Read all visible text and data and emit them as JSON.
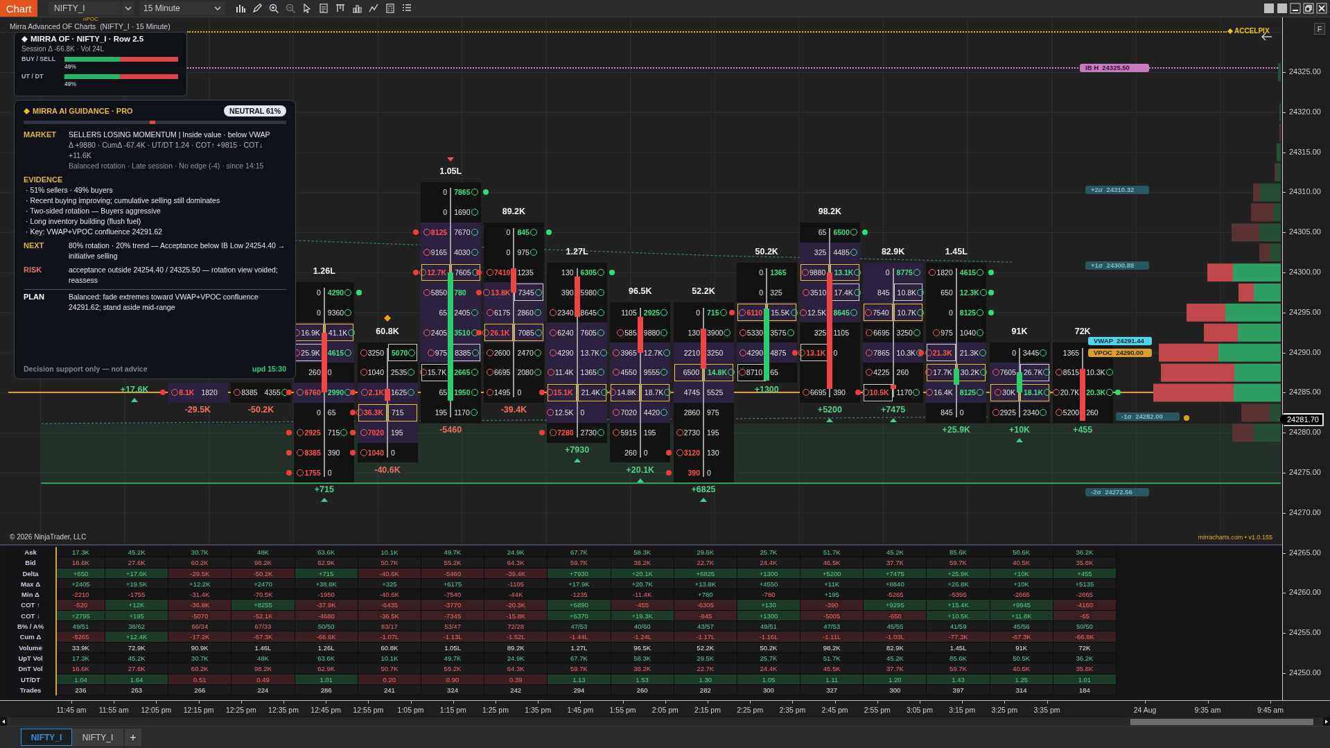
{
  "toolbar": {
    "menu_button": "Chart",
    "instrument": "NIFTY_I",
    "interval": "15 Minute"
  },
  "chart": {
    "title": "Mirra Advanced OF Charts  (NIFTY_I · 15 Minute)",
    "npoc_label": "nPOC",
    "accel_label": "ACCELPIX",
    "credit": "mirracharts.com • v1.0.155",
    "copyright": "© 2026 NinjaTrader, LLC",
    "levels": [
      {
        "kind": "ib_high",
        "name": "IB H",
        "value": "24325.50"
      },
      {
        "kind": "sigma",
        "name": "+2σ",
        "value": "24310.32"
      },
      {
        "kind": "sigma",
        "name": "+1σ",
        "value": "24300.88"
      },
      {
        "kind": "vwap",
        "name": "VWAP",
        "value": "24291.44"
      },
      {
        "kind": "vpoc",
        "name": "VPOC",
        "value": "24290.00"
      },
      {
        "kind": "sigma",
        "name": "-1σ",
        "value": "24282.00"
      },
      {
        "kind": "sigma",
        "name": "-2σ",
        "value": "24272.56"
      }
    ],
    "footprint": {
      "bars": [
        {
          "delta": "+17.6K",
          "delta_positive": true,
          "marker": {
            "kind": "up"
          }
        },
        {
          "delta": "-29.5K",
          "delta_positive": false,
          "rows": [
            {
              "bid": "8.1K",
              "bid_ring": true,
              "bid_strong": true,
              "ask": "1820",
              "shaded": true,
              "dot_left": true
            }
          ]
        },
        {
          "delta": "-50.2K",
          "delta_positive": false,
          "rows": [
            {
              "bid": "8385",
              "bid_ring": true,
              "ask": "4355",
              "ask_ring": true
            }
          ]
        },
        {
          "volume": "1.26L",
          "delta": "+715",
          "delta_positive": true,
          "marker": {
            "kind": "up"
          },
          "candle_rising": false,
          "rows": [
            {
              "bid": "0",
              "ask": "4290",
              "ask_strong": true,
              "ask_ring": true,
              "dot_right": true
            },
            {
              "bid": "0",
              "ask": "9360",
              "ask_ring": true
            },
            {
              "bid": "16.9K",
              "bid_ring": true,
              "bid_highlight": true,
              "ask": "41.1K",
              "ask_ring": true,
              "ask_highlight": true,
              "shaded": true
            },
            {
              "bid": "25.9K",
              "bid_ring": true,
              "bid_outline": true,
              "ask": "4615",
              "ask_strong": true,
              "ask_ring": true,
              "shaded": true
            },
            {
              "bid": "260",
              "ask": "0"
            },
            {
              "bid": "6760",
              "bid_ring": true,
              "bid_strong": true,
              "ask": "2990",
              "ask_strong": true,
              "ask_ring": true,
              "shaded": true,
              "dot_left": true
            },
            {
              "bid": "0",
              "ask": "65"
            },
            {
              "bid": "2925",
              "bid_ring": true,
              "bid_strong": true,
              "ask": "715",
              "ask_ring": true,
              "dot_left": true
            },
            {
              "bid": "8385",
              "bid_ring": true,
              "bid_strong": true,
              "ask": "390",
              "dot_left": true
            },
            {
              "bid": "1755",
              "bid_ring": true,
              "bid_strong": true,
              "ask": "0",
              "dot_left": true
            }
          ]
        },
        {
          "volume": "60.8K",
          "delta": "-40.6K",
          "delta_positive": false,
          "marker": {
            "kind": "diamond"
          },
          "candle_rising": false,
          "rows": [
            {
              "bid": "3250",
              "bid_ring": true,
              "ask": "5070",
              "ask_strong": true,
              "ask_ring": true,
              "ask_outline": true
            },
            {
              "bid": "1040",
              "bid_ring": true,
              "ask": "2535",
              "ask_ring": true
            },
            {
              "bid": "2.1K",
              "bid_ring": true,
              "bid_strong": true,
              "ask": "1625",
              "ask_ring": true,
              "shaded": true,
              "dot_left": true
            },
            {
              "bid": "36.3K",
              "bid_ring": true,
              "bid_strong": true,
              "bid_highlight": true,
              "ask": "715",
              "ask_highlight": true,
              "shaded": true,
              "dot_left": true
            },
            {
              "bid": "7020",
              "bid_ring": true,
              "bid_strong": true,
              "ask": "195",
              "shaded": true,
              "dot_left": true
            },
            {
              "bid": "1040",
              "bid_ring": true,
              "bid_strong": true,
              "ask": "0",
              "dot_left": true
            }
          ]
        },
        {
          "volume": "1.05L",
          "delta": "-5460",
          "delta_positive": false,
          "marker": {
            "kind": "down"
          },
          "candle_rising": true,
          "rows": [
            {
              "bid": "0",
              "ask": "7865",
              "ask_strong": true,
              "ask_ring": true,
              "dot_right": true
            },
            {
              "bid": "0",
              "ask": "1690",
              "ask_ring": true
            },
            {
              "bid": "8125",
              "bid_ring": true,
              "bid_strong": true,
              "ask": "7670",
              "ask_ring": true,
              "shaded": true,
              "dot_left": true
            },
            {
              "bid": "9165",
              "bid_ring": true,
              "ask": "4030",
              "ask_ring": true,
              "shaded": true
            },
            {
              "bid": "12.7K",
              "bid_ring": true,
              "bid_strong": true,
              "bid_highlight": true,
              "ask": "7605",
              "ask_ring": true,
              "ask_highlight": true,
              "shaded": true,
              "dot_left": true
            },
            {
              "bid": "5850",
              "bid_ring": true,
              "ask": "780",
              "ask_strong": true,
              "shaded": true
            },
            {
              "bid": "65",
              "ask": "2405",
              "ask_ring": true,
              "shaded": true
            },
            {
              "bid": "2405",
              "bid_ring": true,
              "ask": "3510",
              "ask_strong": true,
              "ask_ring": true,
              "shaded": true
            },
            {
              "bid": "975",
              "bid_ring": true,
              "ask": "8385",
              "ask_ring": true,
              "ask_outline": true,
              "shaded": true
            },
            {
              "bid": "15.7K",
              "bid_ring": true,
              "bid_outline": true,
              "ask": "2665",
              "ask_strong": true,
              "ask_ring": true
            },
            {
              "bid": "65",
              "ask": "1950",
              "ask_strong": true,
              "ask_ring": true
            },
            {
              "bid": "195",
              "ask": "1170",
              "ask_ring": true
            }
          ]
        },
        {
          "volume": "89.2K",
          "delta": "-39.4K",
          "delta_positive": false,
          "candle_rising": false,
          "rows": [
            {
              "bid": "0",
              "ask": "845",
              "ask_strong": true,
              "ask_ring": true,
              "dot_right": true
            },
            {
              "bid": "0",
              "ask": "975",
              "ask_ring": true
            },
            {
              "bid": "7410",
              "bid_ring": true,
              "bid_strong": true,
              "ask": "1235",
              "dot_left": true
            },
            {
              "bid": "13.8K",
              "bid_ring": true,
              "bid_strong": true,
              "ask": "7345",
              "ask_ring": true,
              "ask_outline": true,
              "shaded": true,
              "dot_left": true
            },
            {
              "bid": "6175",
              "bid_ring": true,
              "ask": "2860",
              "ask_ring": true,
              "shaded": true
            },
            {
              "bid": "26.1K",
              "bid_ring": true,
              "bid_strong": true,
              "bid_highlight": true,
              "ask": "7085",
              "ask_ring": true,
              "ask_highlight": true,
              "shaded": true,
              "dot_left": true
            },
            {
              "bid": "2600",
              "bid_ring": true,
              "ask": "2470",
              "ask_ring": true
            },
            {
              "bid": "6695",
              "bid_ring": true,
              "ask": "2080",
              "ask_ring": true
            },
            {
              "bid": "1495",
              "bid_ring": true,
              "ask": "0"
            }
          ]
        },
        {
          "volume": "1.27L",
          "delta": "+7930",
          "delta_positive": true,
          "marker": {
            "kind": "up"
          },
          "candle_rising": false,
          "rows": [
            {
              "bid": "130",
              "ask": "6305",
              "ask_strong": true,
              "ask_ring": true,
              "dot_right": true
            },
            {
              "bid": "390",
              "ask": "5980",
              "ask_ring": true
            },
            {
              "bid": "2340",
              "bid_ring": true,
              "ask": "8645",
              "ask_ring": true
            },
            {
              "bid": "6240",
              "bid_ring": true,
              "ask": "7605",
              "ask_ring": true,
              "shaded": true
            },
            {
              "bid": "4290",
              "bid_ring": true,
              "ask": "13.7K",
              "ask_ring": true,
              "shaded": true
            },
            {
              "bid": "11.4K",
              "bid_ring": true,
              "ask": "1365",
              "ask_ring": true,
              "shaded": true
            },
            {
              "bid": "15.1K",
              "bid_ring": true,
              "bid_strong": true,
              "bid_highlight": true,
              "ask": "21.4K",
              "ask_ring": true,
              "ask_highlight": true,
              "shaded": true,
              "dot_left": true
            },
            {
              "bid": "12.5K",
              "bid_ring": true,
              "ask": "0",
              "shaded": true
            },
            {
              "bid": "7280",
              "bid_ring": true,
              "bid_strong": true,
              "ask": "2730",
              "ask_ring": true,
              "dot_left": true
            }
          ]
        },
        {
          "volume": "96.5K",
          "delta": "+20.1K",
          "delta_positive": true,
          "marker": {
            "kind": "up"
          },
          "candle_rising": false,
          "rows": [
            {
              "bid": "1105",
              "ask": "2925",
              "ask_strong": true,
              "ask_ring": true
            },
            {
              "bid": "585",
              "bid_ring": true,
              "ask": "9880",
              "ask_ring": true
            },
            {
              "bid": "3965",
              "bid_ring": true,
              "ask": "12.7K",
              "ask_ring": true,
              "shaded": true
            },
            {
              "bid": "4550",
              "bid_ring": true,
              "ask": "9555",
              "ask_ring": true,
              "shaded": true
            },
            {
              "bid": "14.8K",
              "bid_ring": true,
              "bid_highlight": true,
              "ask": "18.7K",
              "ask_ring": true,
              "ask_highlight": true,
              "shaded": true
            },
            {
              "bid": "7020",
              "bid_ring": true,
              "ask": "4420",
              "ask_ring": true,
              "shaded": true
            },
            {
              "bid": "5915",
              "bid_ring": true,
              "ask": "195"
            },
            {
              "bid": "260",
              "ask": "0"
            }
          ]
        },
        {
          "volume": "52.2K",
          "delta": "+6825",
          "delta_positive": true,
          "marker": {
            "kind": "up"
          },
          "candle_rising": false,
          "rows": [
            {
              "bid": "0",
              "ask": "715",
              "ask_strong": true,
              "ask_ring": true
            },
            {
              "bid": "130",
              "ask": "3900",
              "ask_ring": true
            },
            {
              "bid": "2210",
              "ask": "3250",
              "shaded": true
            },
            {
              "bid": "6500",
              "bid_highlight": true,
              "ask": "14.8K",
              "ask_strong": true,
              "ask_ring": true,
              "ask_highlight": true,
              "shaded": true
            },
            {
              "bid": "4745",
              "ask": "5525",
              "shaded": true
            },
            {
              "bid": "2860",
              "ask": "975"
            },
            {
              "bid": "2730",
              "bid_ring": true,
              "ask": "195"
            },
            {
              "bid": "3120",
              "bid_ring": true,
              "bid_strong": true,
              "ask": "130",
              "dot_left": true
            },
            {
              "bid": "390",
              "bid_strong": true,
              "ask": "0",
              "dot_left": true
            }
          ]
        },
        {
          "volume": "50.2K",
          "delta": "+1300",
          "delta_positive": true,
          "candle_rising": true,
          "rows": [
            {
              "bid": "0",
              "ask": "1365",
              "ask_strong": true
            },
            {
              "bid": "0",
              "ask": "325"
            },
            {
              "bid": "6110",
              "bid_ring": true,
              "bid_strong": true,
              "bid_highlight": true,
              "ask": "15.5K",
              "ask_ring": true,
              "ask_highlight": true,
              "shaded": true,
              "dot_left": true
            },
            {
              "bid": "5330",
              "bid_ring": true,
              "ask": "3575",
              "ask_ring": true
            },
            {
              "bid": "4290",
              "bid_ring": true,
              "ask": "4875",
              "shaded": true
            },
            {
              "bid": "8710",
              "bid_ring": true,
              "bid_outline": true,
              "ask": "65"
            }
          ]
        },
        {
          "volume": "98.2K",
          "delta": "+5200",
          "delta_positive": true,
          "marker": {
            "kind": "up"
          },
          "candle_rising": false,
          "rows": [
            {
              "bid": "65",
              "ask": "6500",
              "ask_strong": true,
              "ask_ring": true,
              "dot_right": true
            },
            {
              "bid": "325",
              "ask": "4485",
              "ask_ring": true,
              "shaded": true
            },
            {
              "bid": "9880",
              "bid_ring": true,
              "bid_highlight": true,
              "ask": "13.1K",
              "ask_strong": true,
              "ask_ring": true,
              "ask_highlight": true,
              "shaded": true
            },
            {
              "bid": "3510",
              "bid_ring": true,
              "ask": "17.4K",
              "ask_ring": true,
              "ask_outline": true,
              "shaded": true
            },
            {
              "bid": "12.5K",
              "bid_ring": true,
              "ask": "8645",
              "ask_strong": true,
              "ask_ring": true,
              "shaded": true
            },
            {
              "bid": "325",
              "ask": "1105"
            },
            {
              "bid": "13.1K",
              "bid_ring": true,
              "bid_strong": true,
              "bid_outline": true,
              "ask": "0",
              "dot_left": true
            },
            {
              "gap": true
            },
            {
              "bid": "6695",
              "bid_ring": true,
              "ask": "390"
            }
          ]
        },
        {
          "volume": "82.9K",
          "delta": "+7475",
          "delta_positive": true,
          "marker": {
            "kind": "up"
          },
          "candle_rising": false,
          "rows": [
            {
              "bid": "0",
              "ask": "8775",
              "ask_strong": true,
              "ask_ring": true,
              "shaded": true
            },
            {
              "bid": "845",
              "ask": "10.8K",
              "ask_ring": true,
              "ask_outline": true,
              "shaded": true
            },
            {
              "bid": "7540",
              "bid_ring": true,
              "bid_highlight": true,
              "ask": "10.7K",
              "ask_ring": true,
              "ask_highlight": true,
              "shaded": true
            },
            {
              "bid": "6695",
              "bid_ring": true,
              "ask": "3250",
              "ask_ring": true
            },
            {
              "bid": "7865",
              "bid_ring": true,
              "ask": "10.3K",
              "ask_ring": true,
              "shaded": true
            },
            {
              "bid": "4225",
              "bid_ring": true,
              "ask": "260"
            },
            {
              "bid": "10.5K",
              "bid_ring": true,
              "bid_strong": true,
              "bid_outline": true,
              "ask": "1170",
              "ask_ring": true,
              "dot_left": true
            }
          ]
        },
        {
          "volume": "1.45L",
          "delta": "+25.9K",
          "delta_positive": true,
          "candle_rising": true,
          "rows": [
            {
              "bid": "1820",
              "bid_ring": true,
              "ask": "4615",
              "ask_strong": true,
              "ask_ring": true,
              "dot_right": true
            },
            {
              "bid": "650",
              "ask": "12.3K",
              "ask_strong": true,
              "ask_ring": true,
              "dot_right": true
            },
            {
              "bid": "0",
              "ask": "8125",
              "ask_strong": true,
              "ask_ring": true,
              "dot_right": true
            },
            {
              "bid": "975",
              "bid_ring": true,
              "ask": "1040",
              "ask_ring": true
            },
            {
              "bid": "21.3K",
              "bid_ring": true,
              "bid_strong": true,
              "bid_outline": true,
              "ask": "21.3K",
              "ask_ring": true,
              "shaded": true,
              "dot_left": true
            },
            {
              "bid": "17.7K",
              "bid_ring": true,
              "bid_highlight": true,
              "ask": "30.2K",
              "ask_ring": true,
              "ask_highlight": true,
              "shaded": true
            },
            {
              "bid": "16.4K",
              "bid_ring": true,
              "ask": "8125",
              "ask_strong": true,
              "ask_ring": true,
              "shaded": true
            },
            {
              "bid": "845",
              "ask": "0"
            }
          ]
        },
        {
          "volume": "91K",
          "delta": "+10K",
          "delta_positive": true,
          "marker": {
            "kind": "up"
          },
          "candle_rising": true,
          "rows": [
            {
              "bid": "0",
              "ask": "3445",
              "ask_ring": true
            },
            {
              "bid": "7605",
              "bid_ring": true,
              "ask": "26.7K",
              "ask_ring": true,
              "ask_outline": true,
              "shaded": true
            },
            {
              "bid": "30K",
              "bid_ring": true,
              "bid_highlight": true,
              "ask": "18.1K",
              "ask_strong": true,
              "ask_ring": true,
              "ask_highlight": true,
              "shaded": true
            },
            {
              "bid": "2925",
              "bid_ring": true,
              "ask": "2340",
              "ask_ring": true
            }
          ]
        },
        {
          "volume": "72K",
          "delta": "+455",
          "delta_positive": true,
          "candle_rising": false,
          "rows": [
            {
              "bid": "1365"
            },
            {
              "bid": "8515",
              "bid_ring": true,
              "ask": "10.3K",
              "ask_ring": true
            },
            {
              "bid": "20.7K",
              "bid_ring": true,
              "ask": "20.3K",
              "ask_strong": true,
              "ask_ring": true,
              "dot_right": true
            },
            {
              "bid": "5200",
              "bid_ring": true,
              "ask": "260"
            }
          ]
        }
      ]
    }
  },
  "of_panel": {
    "title": "MIRRA OF · NIFTY_I · Row 2.5",
    "session": "Session Δ -66.8K  ·  Vol 24L",
    "meters": [
      {
        "label": "BUY / SELL",
        "level": 0.49,
        "reading": "49%"
      },
      {
        "label": "UT / DT",
        "level": 0.49,
        "reading": "49%"
      }
    ]
  },
  "guidance": {
    "title": "MIRRA AI GUIDANCE · PRO",
    "bias": "NEUTRAL 61%",
    "gauge": {
      "level": 0.49
    },
    "sections": [
      {
        "kind": "text",
        "heading": "MARKET",
        "color": "#e2b43c",
        "lines": [
          {
            "text": "SELLERS LOSING MOMENTUM  |  Inside value · below VWAP",
            "kind": "primary"
          },
          {
            "text": "Δ +9880 · CumΔ -67.4K · UT/DT 1.24 · COT↑ +9815 · COT↓ +11.6K",
            "kind": "secondary"
          },
          {
            "text": "Balanced rotation · Late session  ·  No edge (-4)  ·  since 14:15",
            "kind": "muted"
          }
        ]
      },
      {
        "kind": "list",
        "heading": "EVIDENCE",
        "color": "#e2b43c",
        "lines": [
          {
            "text": "· 51% sellers · 49% buyers",
            "kind": "primary"
          },
          {
            "text": "· Recent buying improving; cumulative selling still dominates",
            "kind": "primary"
          },
          {
            "text": "· Two-sided rotation — Buyers aggressive",
            "kind": "primary"
          },
          {
            "text": "· Long inventory building (flush fuel)",
            "kind": "primary"
          },
          {
            "text": "· Key: VWAP+VPOC confluence 24291.62",
            "kind": "primary"
          }
        ]
      },
      {
        "kind": "text",
        "heading": "NEXT",
        "color": "#e2b43c",
        "lines": [
          {
            "text": "80% rotation · 20% trend — Acceptance below IB Low 24254.40 → initiative selling",
            "kind": "primary"
          }
        ]
      },
      {
        "kind": "text",
        "heading": "RISK",
        "color": "#e8736b",
        "lines": [
          {
            "text": "acceptance outside 24254.40 / 24325.50 — rotation view voided; reassess",
            "kind": "primary"
          }
        ]
      },
      {
        "kind": "text",
        "heading": "PLAN",
        "color": "#ffffff",
        "divider": true,
        "lines": [
          {
            "text": "Balanced: fade extremes toward VWAP+VPOC confluence 24291.62; stand aside mid-range",
            "kind": "primary"
          }
        ]
      }
    ],
    "footer": "Decision support only — not advice",
    "updated": "upd 15:30"
  },
  "stats_table": {
    "rows": [
      {
        "label": "Ask",
        "cells": [
          "17.3K",
          "45.2K",
          "30.7K",
          "48K",
          "63.6K",
          "10.1K",
          "49.7K",
          "24.9K",
          "67.7K",
          "58.3K",
          "29.5K",
          "25.7K",
          "51.7K",
          "45.2K",
          "85.6K",
          "50.5K",
          "36.2K"
        ],
        "rising": [
          true,
          true,
          true,
          true,
          true,
          true,
          true,
          true,
          true,
          true,
          true,
          true,
          true,
          true,
          true,
          true,
          true
        ]
      },
      {
        "label": "Bid",
        "cells": [
          "16.6K",
          "27.6K",
          "60.2K",
          "98.2K",
          "62.9K",
          "50.7K",
          "55.2K",
          "64.3K",
          "59.7K",
          "38.2K",
          "22.7K",
          "24.4K",
          "46.5K",
          "37.7K",
          "59.7K",
          "40.5K",
          "35.8K"
        ],
        "rising": [
          false,
          false,
          false,
          false,
          false,
          false,
          false,
          false,
          false,
          false,
          false,
          false,
          false,
          false,
          false,
          false,
          false
        ]
      },
      {
        "label": "Delta",
        "filled": true,
        "cells": [
          "+650",
          "+17.6K",
          "-29.5K",
          "-50.2K",
          "+715",
          "-40.6K",
          "-5460",
          "-39.4K",
          "+7930",
          "+20.1K",
          "+6825",
          "+1300",
          "+5200",
          "+7475",
          "+25.9K",
          "+10K",
          "+455"
        ],
        "rising": [
          true,
          true,
          false,
          false,
          true,
          false,
          false,
          false,
          true,
          true,
          true,
          true,
          true,
          true,
          true,
          true,
          true
        ]
      },
      {
        "label": "Max Δ",
        "cells": [
          "+2405",
          "+19.5K",
          "+12.2K",
          "+2470",
          "+38.8K",
          "+325",
          "+6175",
          "-1105",
          "+17.9K",
          "+20.7K",
          "+13.8K",
          "+4550",
          "+11K",
          "+8840",
          "+26.8K",
          "+10K",
          "+5135"
        ],
        "rising": [
          true,
          true,
          true,
          true,
          true,
          true,
          true,
          false,
          true,
          true,
          true,
          true,
          true,
          true,
          true,
          true,
          true
        ]
      },
      {
        "label": "Min Δ",
        "cells": [
          "-2210",
          "-1755",
          "-31.4K",
          "-70.5K",
          "-1950",
          "-40.6K",
          "-7540",
          "-44K",
          "-1235",
          "-11.4K",
          "+780",
          "-780",
          "+195",
          "-5265",
          "-5395",
          "-2665",
          "-2665"
        ],
        "rising": [
          false,
          false,
          false,
          false,
          false,
          false,
          false,
          false,
          false,
          false,
          true,
          false,
          true,
          false,
          false,
          false,
          false
        ]
      },
      {
        "label": "COT ↑",
        "filled": true,
        "cells": [
          "-520",
          "+12K",
          "-36.8K",
          "+8255",
          "-37.9K",
          "-6435",
          "-3770",
          "-20.3K",
          "+6890",
          "-455",
          "-6305",
          "+130",
          "-390",
          "+9295",
          "+15.4K",
          "+9945",
          "-4160"
        ],
        "rising": [
          false,
          true,
          false,
          true,
          false,
          false,
          false,
          false,
          true,
          false,
          false,
          true,
          false,
          true,
          true,
          true,
          false
        ]
      },
      {
        "label": "COT ↓",
        "filled": true,
        "cells": [
          "+2795",
          "+195",
          "-5070",
          "-52.1K",
          "-4680",
          "-36.5K",
          "-7345",
          "-15.8K",
          "+6370",
          "+19.3K",
          "-845",
          "+1300",
          "-5005",
          "-650",
          "+10.5K",
          "+11.8K",
          "-65"
        ],
        "rising": [
          true,
          true,
          false,
          false,
          false,
          false,
          false,
          false,
          true,
          true,
          false,
          true,
          false,
          false,
          true,
          true,
          false
        ]
      },
      {
        "label": "B% / A%",
        "cells": [
          "49/51",
          "38/62",
          "66/34",
          "67/33",
          "50/50",
          "83/17",
          "53/47",
          "72/28",
          "47/53",
          "40/60",
          "43/57",
          "49/51",
          "47/53",
          "45/55",
          "41/59",
          "45/56",
          "50/50"
        ],
        "rising": [
          true,
          true,
          false,
          false,
          true,
          false,
          false,
          false,
          true,
          true,
          true,
          true,
          true,
          true,
          true,
          true,
          true
        ]
      },
      {
        "label": "Cum Δ",
        "filled": true,
        "cells": [
          "-5265",
          "+12.4K",
          "-17.2K",
          "-67.3K",
          "-66.6K",
          "-1.07L",
          "-1.13L",
          "-1.52L",
          "-1.44L",
          "-1.24L",
          "-1.17L",
          "-1.16L",
          "-1.11L",
          "-1.03L",
          "-77.3K",
          "-67.3K",
          "-66.8K"
        ],
        "rising": [
          false,
          true,
          false,
          false,
          false,
          false,
          false,
          false,
          false,
          false,
          false,
          false,
          false,
          false,
          false,
          false,
          false
        ]
      },
      {
        "label": "Volume",
        "cells": [
          "33.9K",
          "72.9K",
          "90.9K",
          "1.46L",
          "1.26L",
          "60.8K",
          "1.05L",
          "89.2K",
          "1.27L",
          "96.5K",
          "52.2K",
          "50.2K",
          "98.2K",
          "82.9K",
          "1.45L",
          "91K",
          "72K"
        ]
      },
      {
        "label": "UpT Vol",
        "cells": [
          "17.3K",
          "45.2K",
          "30.7K",
          "48K",
          "63.6K",
          "10.1K",
          "49.7K",
          "24.9K",
          "67.7K",
          "58.3K",
          "29.5K",
          "25.7K",
          "51.7K",
          "45.2K",
          "85.6K",
          "50.5K",
          "36.2K"
        ],
        "rising": [
          true,
          true,
          true,
          true,
          true,
          true,
          true,
          true,
          true,
          true,
          true,
          true,
          true,
          true,
          true,
          true,
          true
        ]
      },
      {
        "label": "DnT Vol",
        "cells": [
          "16.6K",
          "27.6K",
          "60.2K",
          "98.2K",
          "62.9K",
          "50.7K",
          "55.2K",
          "64.3K",
          "59.7K",
          "38.2K",
          "22.7K",
          "24.4K",
          "46.5K",
          "37.7K",
          "59.7K",
          "40.5K",
          "35.8K"
        ],
        "rising": [
          false,
          false,
          false,
          false,
          false,
          false,
          false,
          false,
          false,
          false,
          false,
          false,
          false,
          false,
          false,
          false,
          false
        ]
      },
      {
        "label": "UT/DT",
        "filled": true,
        "cells": [
          "1.04",
          "1.64",
          "0.51",
          "0.49",
          "1.01",
          "0.20",
          "0.90",
          "0.39",
          "1.13",
          "1.53",
          "1.30",
          "1.05",
          "1.11",
          "1.20",
          "1.43",
          "1.25",
          "1.01"
        ],
        "rising": [
          true,
          true,
          false,
          false,
          true,
          false,
          false,
          false,
          true,
          true,
          true,
          true,
          true,
          true,
          true,
          true,
          true
        ]
      },
      {
        "label": "Trades",
        "cells": [
          "236",
          "263",
          "266",
          "224",
          "286",
          "241",
          "324",
          "242",
          "294",
          "260",
          "282",
          "300",
          "327",
          "300",
          "397",
          "314",
          "184"
        ]
      }
    ]
  },
  "price_axis": {
    "labels": [
      "24325.00",
      "24320.00",
      "24315.00",
      "24310.00",
      "24305.00",
      "24300.00",
      "24295.00",
      "24290.00",
      "24285.00",
      "24280.00",
      "24275.00",
      "24270.00",
      "24265.00",
      "24260.00",
      "24255.00",
      "24250.00"
    ],
    "last_price": "24281.70",
    "panel_button": "F"
  },
  "time_axis": {
    "labels": [
      "11:45 am",
      "11:55 am",
      "12:05 pm",
      "12:15 pm",
      "12:25 pm",
      "12:35 pm",
      "12:45 pm",
      "12:55 pm",
      "1:05 pm",
      "1:15 pm",
      "1:25 pm",
      "1:35 pm",
      "1:45 pm",
      "1:55 pm",
      "2:05 pm",
      "2:15 pm",
      "2:25 pm",
      "2:35 pm",
      "2:45 pm",
      "2:55 pm",
      "3:05 pm",
      "3:15 pm",
      "3:25 pm",
      "3:35 pm",
      "24 Aug",
      "9:35 am",
      "9:45 am"
    ]
  },
  "tabs": [
    {
      "label": "NIFTY_I",
      "selected": true
    },
    {
      "label": "NIFTY_I",
      "selected": false
    }
  ],
  "add_tab": "+"
}
